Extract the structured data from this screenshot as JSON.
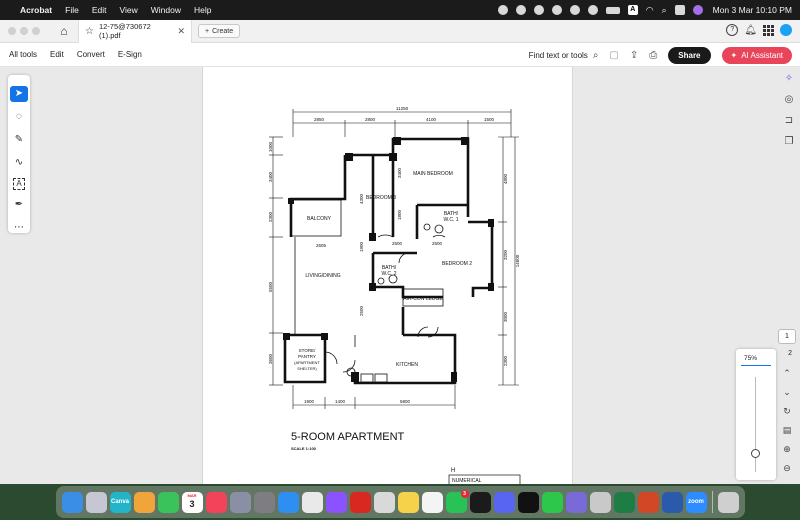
{
  "menubar": {
    "app_name": "Acrobat",
    "items": [
      "File",
      "Edit",
      "View",
      "Window",
      "Help"
    ],
    "clock": "Mon 3 Mar  10:10 PM",
    "status_icons": [
      "assistant-icon",
      "bluetooth-icon",
      "record-icon",
      "cloud-icon",
      "grammarly-icon",
      "play-icon",
      "battery-icon",
      "keyboard-input-A-icon",
      "wifi-icon",
      "search-icon",
      "control-center-icon",
      "siri-icon"
    ],
    "input_letter": "A"
  },
  "tabbar": {
    "tab_title": "12-75@730672 (1).pdf",
    "create_label": "Create"
  },
  "toolbar": {
    "menu": [
      "All tools",
      "Edit",
      "Convert",
      "E-Sign"
    ],
    "find_label": "Find text or tools",
    "share_label": "Share",
    "ai_label": "AI Assistant"
  },
  "tools": [
    "select-tool-icon",
    "comment-tool-icon",
    "pen-tool-icon",
    "lasso-tool-icon",
    "text-select-tool-icon",
    "fill-sign-tool-icon",
    "more-tools-icon"
  ],
  "rightrail": [
    "ai-insights-icon",
    "comments-panel-icon",
    "bookmarks-icon",
    "pages-icon"
  ],
  "pagenav": {
    "current_page": "1",
    "total_pages": "2"
  },
  "zoom": {
    "value": "75%",
    "slider_fraction": 0.8
  },
  "floorplan": {
    "total_width": "11250",
    "top_dims": [
      "2850",
      "2800",
      "4100",
      "1500"
    ],
    "bottom_dims": [
      "1900",
      "1400",
      "5800"
    ],
    "left_dims": [
      "1000",
      "3400",
      "2300",
      "5500",
      "3600"
    ],
    "right_dims": [
      "4800",
      "3200",
      "14600",
      "3000",
      "2300"
    ],
    "inner_dims": [
      "4300",
      "3400",
      "1800",
      "2500",
      "2500",
      "1900",
      "5800",
      "2500",
      "2605"
    ],
    "rooms": {
      "bedroom3": "BEDROOM 3",
      "main_bedroom": "MAIN BEDROOM",
      "bath1_a": "BATH/",
      "bath1_b": "W.C. 1",
      "balcony": "BALCONY",
      "living": "LIVING/DINING",
      "bath2_a": "BATH/",
      "bath2_b": "W.C. 2",
      "bedroom2": "BEDROOM 2",
      "aircon": "AIR-CON LEDGE",
      "store_a": "STORE/",
      "store_b": "PANTRY",
      "store_c": "(APARTMENT",
      "store_d": "SHELTER)",
      "kitchen": "KITCHEN"
    },
    "title": "5-ROOM  APARTMENT",
    "scale": "SCALE  1:100",
    "table_header": "NUMERICAL",
    "table_letter": "H"
  },
  "dock": {
    "apps": [
      {
        "name": "finder-app",
        "color": "#3a8ee6",
        "label": ""
      },
      {
        "name": "launchpad-app",
        "color": "#c7c7d3",
        "label": ""
      },
      {
        "name": "canva-app",
        "color": "#22b5c9",
        "label": "Canva"
      },
      {
        "name": "photos-app",
        "color": "#f0a43a",
        "label": ""
      },
      {
        "name": "facetime-app",
        "color": "#3ac35b",
        "label": ""
      },
      {
        "name": "calendar-app",
        "color": "#ffffff",
        "label": "3"
      },
      {
        "name": "music-app",
        "color": "#f2435a",
        "label": ""
      },
      {
        "name": "screenshot-app",
        "color": "#8a8fa5",
        "label": ""
      },
      {
        "name": "settings-app",
        "color": "#7d7d82",
        "label": ""
      },
      {
        "name": "app-store-app",
        "color": "#2f8ff0",
        "label": ""
      },
      {
        "name": "chrome-app",
        "color": "#e9e9e9",
        "label": ""
      },
      {
        "name": "messenger-app",
        "color": "#8c52ff",
        "label": ""
      },
      {
        "name": "acrobat-app",
        "color": "#d8281f",
        "label": ""
      },
      {
        "name": "system-prefs-app",
        "color": "#d9d9d9",
        "label": ""
      },
      {
        "name": "notes-app",
        "color": "#f5d24a",
        "label": ""
      },
      {
        "name": "reminders-app",
        "color": "#f4f4f4",
        "label": ""
      },
      {
        "name": "whatsapp-app",
        "color": "#29c257",
        "label": ""
      },
      {
        "name": "capcut-app",
        "color": "#1b1b1b",
        "label": ""
      },
      {
        "name": "discord-app",
        "color": "#5865f2",
        "label": ""
      },
      {
        "name": "tiktok-app",
        "color": "#111111",
        "label": ""
      },
      {
        "name": "wechat-app",
        "color": "#2dc74c",
        "label": ""
      },
      {
        "name": "textedit-app",
        "color": "#7a6ad8",
        "label": ""
      },
      {
        "name": "preview-app",
        "color": "#c9c9c9",
        "label": ""
      },
      {
        "name": "excel-app",
        "color": "#1e7d45",
        "label": ""
      },
      {
        "name": "powerpoint-app",
        "color": "#d24726",
        "label": ""
      },
      {
        "name": "word-app",
        "color": "#2b5aad",
        "label": ""
      },
      {
        "name": "zoom-app",
        "color": "#2d8cff",
        "label": "zoom"
      },
      {
        "name": "trash-app",
        "color": "#cfcfcf",
        "label": ""
      }
    ],
    "calendar_month": "MAR",
    "whatsapp_badge": "3"
  }
}
